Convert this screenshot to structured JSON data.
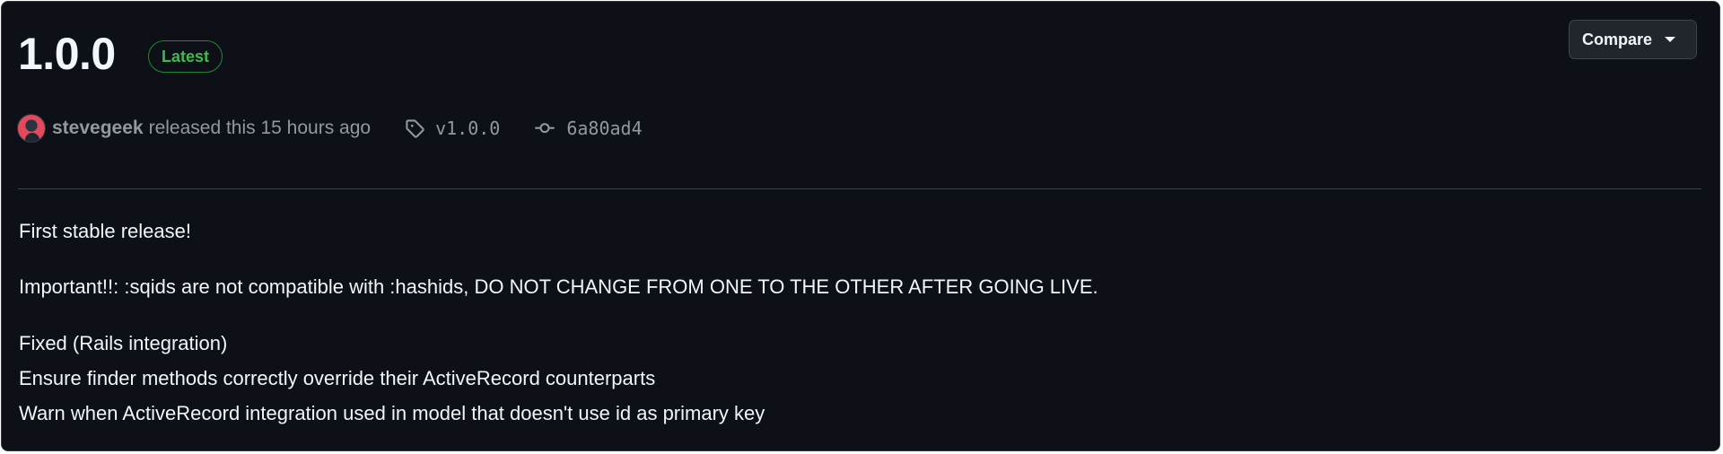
{
  "release": {
    "title": "1.0.0",
    "badge": "Latest",
    "compare_label": "Compare",
    "author": "stevegeek",
    "released_text": "released this 15 hours ago",
    "tag": "v1.0.0",
    "commit": "6a80ad4"
  },
  "notes": {
    "intro": "First stable release!",
    "important": "Important!!: :sqids are not compatible with :hashids, DO NOT CHANGE FROM ONE TO THE OTHER AFTER GOING LIVE.",
    "fixed_heading": "Fixed (Rails integration)",
    "fixed_items": [
      "Ensure finder methods correctly override their ActiveRecord counterparts",
      "Warn when ActiveRecord integration used in model that doesn't use id as primary key"
    ]
  },
  "colors": {
    "background": "#0d1117",
    "badge_green": "#3fb950",
    "muted_text": "#9198a1",
    "primary_text": "#f0f6fc"
  },
  "icons": {
    "tag": "tag-icon",
    "commit": "git-commit-icon",
    "dropdown": "triangle-down-icon",
    "avatar": "avatar"
  }
}
